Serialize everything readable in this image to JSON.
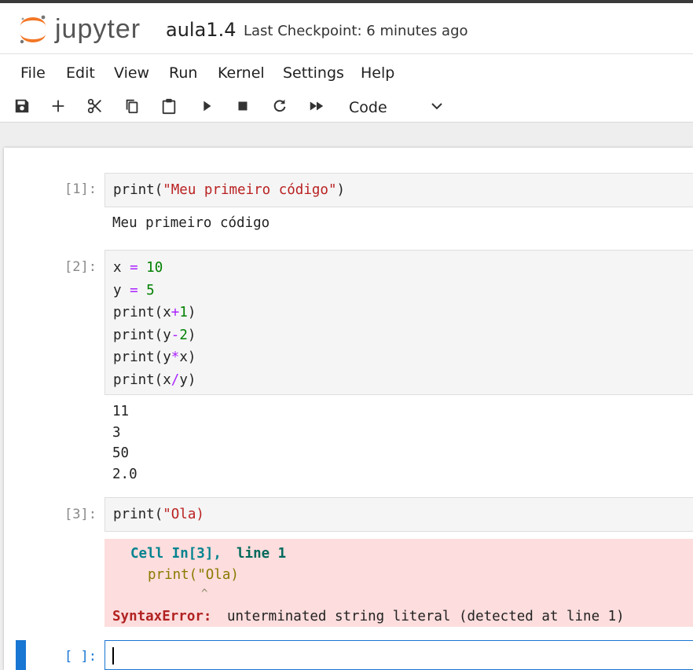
{
  "header": {
    "logo_text": "jupyter",
    "notebook_name": "aula1.4",
    "checkpoint": "Last Checkpoint: 6 minutes ago"
  },
  "menu": [
    "File",
    "Edit",
    "View",
    "Run",
    "Kernel",
    "Settings",
    "Help"
  ],
  "toolbar": {
    "icons": [
      "save-icon",
      "add-icon",
      "cut-icon",
      "copy-icon",
      "paste-icon",
      "run-icon",
      "stop-icon",
      "restart-icon",
      "fast-forward-icon"
    ],
    "cell_type": "Code"
  },
  "colors": {
    "accent": "#1976d2",
    "string": "#ba2121",
    "number": "#008000",
    "operator": "#aa22ff",
    "error_bg": "#fddddd",
    "error_name": "#b22222",
    "traceback_cyan": "#00838f",
    "traceback_green": "#00695c",
    "traceback_olive": "#8a7a00"
  },
  "cells": [
    {
      "prompt": "[1]:",
      "code": {
        "fn": "print",
        "open": "(",
        "str": "\"Meu primeiro código\"",
        "close": ")"
      },
      "output": [
        "Meu primeiro código"
      ]
    },
    {
      "prompt": "[2]:",
      "code_lines": [
        {
          "a": "x ",
          "op": "=",
          "b": " ",
          "num": "10"
        },
        {
          "a": "y ",
          "op": "=",
          "b": " ",
          "num": "5"
        },
        {
          "a": "print(x",
          "op": "+",
          "num": "1",
          "c": ")"
        },
        {
          "a": "print(y",
          "op": "-",
          "num": "2",
          "c": ")"
        },
        {
          "a": "print(y",
          "op": "*",
          "c": "x)"
        },
        {
          "a": "print(x",
          "op": "/",
          "c": "y)"
        }
      ],
      "output": [
        "11",
        "3",
        "50",
        "2.0"
      ]
    },
    {
      "prompt": "[3]:",
      "code": {
        "fn": "print",
        "open": "(",
        "str": "\"Ola)"
      },
      "error": {
        "cell_ref": "Cell In[3],",
        "line_ref": "line 1",
        "source": "print(\"Ola)",
        "caret": "^",
        "name": "SyntaxError:",
        "message": "unterminated string literal (detected at line 1)"
      }
    },
    {
      "prompt": "[ ]:"
    }
  ]
}
